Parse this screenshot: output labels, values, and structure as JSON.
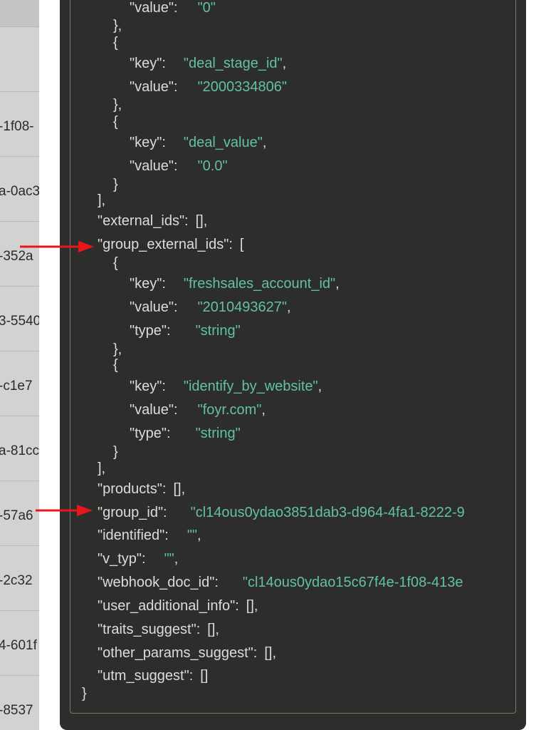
{
  "left_panel": {
    "rows": [
      "-1f08-",
      "a-0ac3",
      "-352a",
      "3-5540",
      "-c1e7",
      "a-81cc",
      "-57a6",
      "-2c32",
      "4-601f",
      "-8537"
    ]
  },
  "json_view": {
    "lines": [
      {
        "tokens": [
          [
            "k",
            "\"value\":"
          ],
          [
            "s",
            "\"0\""
          ]
        ]
      },
      {
        "tokens": [
          [
            "p",
            "},"
          ]
        ]
      },
      {
        "tokens": [
          [
            "p",
            "{"
          ]
        ]
      },
      {
        "tokens": [
          [
            "k",
            "\"key\":"
          ],
          [
            "s",
            "\"deal_stage_id\""
          ],
          [
            "p",
            ","
          ]
        ]
      },
      {
        "tokens": [
          [
            "k",
            "\"value\":"
          ],
          [
            "s",
            "\"2000334806\""
          ]
        ]
      },
      {
        "tokens": [
          [
            "p",
            "},"
          ]
        ]
      },
      {
        "tokens": [
          [
            "p",
            "{"
          ]
        ]
      },
      {
        "tokens": [
          [
            "k",
            "\"key\":"
          ],
          [
            "s",
            "\"deal_value\""
          ],
          [
            "p",
            ","
          ]
        ]
      },
      {
        "tokens": [
          [
            "k",
            "\"value\":"
          ],
          [
            "s",
            "\"0.0\""
          ]
        ]
      },
      {
        "tokens": [
          [
            "p",
            "}"
          ]
        ]
      },
      {
        "tokens": [
          [
            "p",
            "],"
          ]
        ]
      },
      {
        "tokens": [
          [
            "k",
            "\"external_ids\":"
          ],
          [
            "p",
            "[],"
          ]
        ]
      },
      {
        "tokens": [
          [
            "k",
            "\"group_external_ids\":"
          ],
          [
            "p",
            "["
          ]
        ]
      },
      {
        "tokens": [
          [
            "p",
            "{"
          ]
        ]
      },
      {
        "tokens": [
          [
            "k",
            "\"key\":"
          ],
          [
            "s",
            "\"freshsales_account_id\""
          ],
          [
            "p",
            ","
          ]
        ]
      },
      {
        "tokens": [
          [
            "k",
            "\"value\":"
          ],
          [
            "s",
            "\"2010493627\""
          ],
          [
            "p",
            ","
          ]
        ]
      },
      {
        "tokens": [
          [
            "k",
            "\"type\":"
          ],
          [
            "s",
            "\"string\""
          ]
        ]
      },
      {
        "tokens": [
          [
            "p",
            "},"
          ]
        ]
      },
      {
        "tokens": [
          [
            "p",
            "{"
          ]
        ]
      },
      {
        "tokens": [
          [
            "k",
            "\"key\":"
          ],
          [
            "s",
            "\"identify_by_website\""
          ],
          [
            "p",
            ","
          ]
        ]
      },
      {
        "tokens": [
          [
            "k",
            "\"value\":"
          ],
          [
            "s",
            "\"foyr.com\""
          ],
          [
            "p",
            ","
          ]
        ]
      },
      {
        "tokens": [
          [
            "k",
            "\"type\":"
          ],
          [
            "s",
            "\"string\""
          ]
        ]
      },
      {
        "tokens": [
          [
            "p",
            "}"
          ]
        ]
      },
      {
        "tokens": [
          [
            "p",
            "],"
          ]
        ]
      },
      {
        "tokens": [
          [
            "k",
            "\"products\":"
          ],
          [
            "p",
            "[],"
          ]
        ]
      },
      {
        "tokens": [
          [
            "k",
            "\"group_id\":"
          ],
          [
            "s",
            "\"cl14ous0ydao3851dab3-d964-4fa1-8222-9"
          ]
        ]
      },
      {
        "tokens": [
          [
            "k",
            "\"identified\":"
          ],
          [
            "s",
            "\"\""
          ],
          [
            "p",
            ","
          ]
        ]
      },
      {
        "tokens": [
          [
            "k",
            "\"v_typ\":"
          ],
          [
            "s",
            "\"\""
          ],
          [
            "p",
            ","
          ]
        ]
      },
      {
        "tokens": [
          [
            "k",
            "\"webhook_doc_id\":"
          ],
          [
            "s",
            "\"cl14ous0ydao15c67f4e-1f08-413e"
          ]
        ]
      },
      {
        "tokens": [
          [
            "k",
            "\"user_additional_info\":"
          ],
          [
            "p",
            "[],"
          ]
        ]
      },
      {
        "tokens": [
          [
            "k",
            "\"traits_suggest\":"
          ],
          [
            "p",
            "[],"
          ]
        ]
      },
      {
        "tokens": [
          [
            "k",
            "\"other_params_suggest\":"
          ],
          [
            "p",
            "[],"
          ]
        ]
      },
      {
        "tokens": [
          [
            "k",
            "\"utm_suggest\":"
          ],
          [
            "p",
            "[]"
          ]
        ]
      },
      {
        "tokens": [
          [
            "p",
            "}"
          ]
        ]
      }
    ]
  },
  "colors": {
    "key": "#dcdcd8",
    "string": "#63c29e",
    "background": "#2d2d2b",
    "arrow": "#e8161b"
  }
}
